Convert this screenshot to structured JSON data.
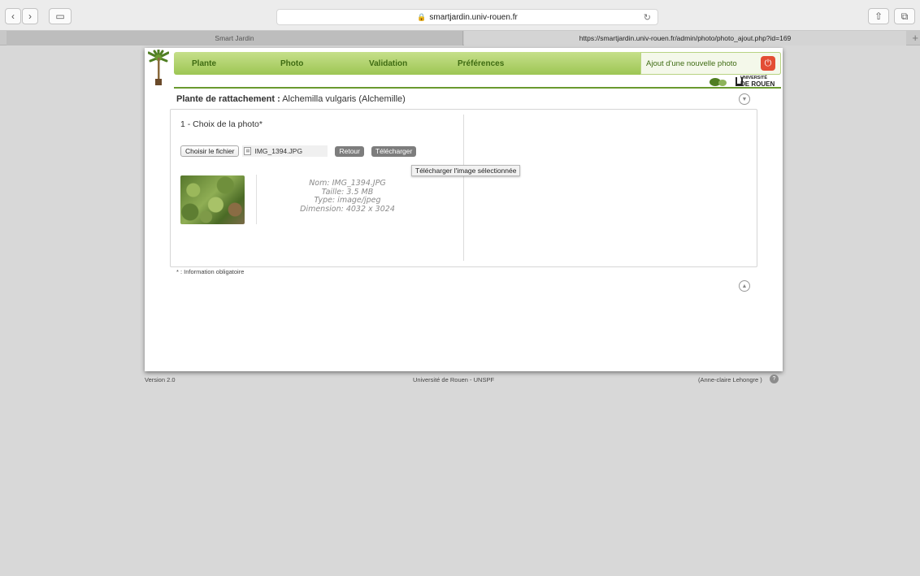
{
  "browser": {
    "url": "smartjardin.univ-rouen.fr",
    "tabs": [
      {
        "title": "Smart Jardin"
      },
      {
        "title": "https://smartjardin.univ-rouen.fr/admin/photo/photo_ajout.php?id=169"
      }
    ]
  },
  "nav": {
    "items": [
      "Plante",
      "Photo",
      "Validation",
      "Préférences"
    ],
    "ajout": "Ajout d'une nouvelle photo"
  },
  "logo": {
    "univ_line1": "UNIVERSITÉ",
    "univ_line2": "DE ROUEN"
  },
  "content": {
    "plante_label": "Plante de rattachement :",
    "plante_value": "Alchemilla vulgaris (Alchemille)",
    "step": "1 - Choix de la photo*",
    "choose_button": "Choisir le fichier",
    "file_name": "IMG_1394.JPG",
    "retour_button": "Retour",
    "telecharger_button": "Télécharger",
    "tooltip": "Télécharger l'image sélectionnée",
    "info": {
      "nom": "Nom: IMG_1394.JPG",
      "taille": "Taille: 3.5 MB",
      "type": "Type: image/jpeg",
      "dimension": "Dimension: 4032 x 3024"
    },
    "obligatoire": "* : Information obligatoire"
  },
  "footer": {
    "version": "Version 2.0",
    "center": "Université de Rouen - UNSPF",
    "user": "(Anne-claire Lehongre )"
  }
}
